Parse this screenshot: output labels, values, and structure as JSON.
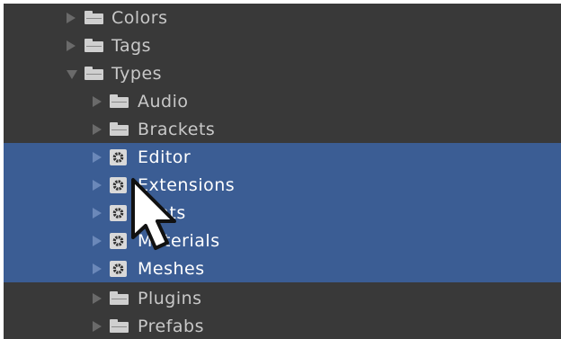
{
  "tree": {
    "items": [
      {
        "label": "Colors",
        "expanded": false,
        "selected": false,
        "icon": "folder-icon"
      },
      {
        "label": "Tags",
        "expanded": false,
        "selected": false,
        "icon": "folder-icon"
      },
      {
        "label": "Types",
        "expanded": true,
        "selected": false,
        "icon": "folder-icon"
      },
      {
        "label": "Audio",
        "expanded": false,
        "selected": false,
        "icon": "folder-icon"
      },
      {
        "label": "Brackets",
        "expanded": false,
        "selected": false,
        "icon": "folder-icon"
      },
      {
        "label": "Editor",
        "expanded": false,
        "selected": true,
        "icon": "gear-folder-icon"
      },
      {
        "label": "Extensions",
        "expanded": false,
        "selected": true,
        "icon": "gear-folder-icon"
      },
      {
        "label": "Fonts",
        "expanded": false,
        "selected": true,
        "icon": "gear-folder-icon"
      },
      {
        "label": "Materials",
        "expanded": false,
        "selected": true,
        "icon": "gear-folder-icon"
      },
      {
        "label": "Meshes",
        "expanded": false,
        "selected": true,
        "icon": "gear-folder-icon"
      },
      {
        "label": "Plugins",
        "expanded": false,
        "selected": false,
        "icon": "folder-icon"
      },
      {
        "label": "Prefabs",
        "expanded": false,
        "selected": false,
        "icon": "folder-icon"
      }
    ]
  },
  "colors": {
    "panel_bg": "#393939",
    "selection": "#3b5d94",
    "text": "#c8c8c8",
    "text_selected": "#ffffff"
  },
  "cursor": {
    "icon": "mouse-pointer-icon"
  }
}
